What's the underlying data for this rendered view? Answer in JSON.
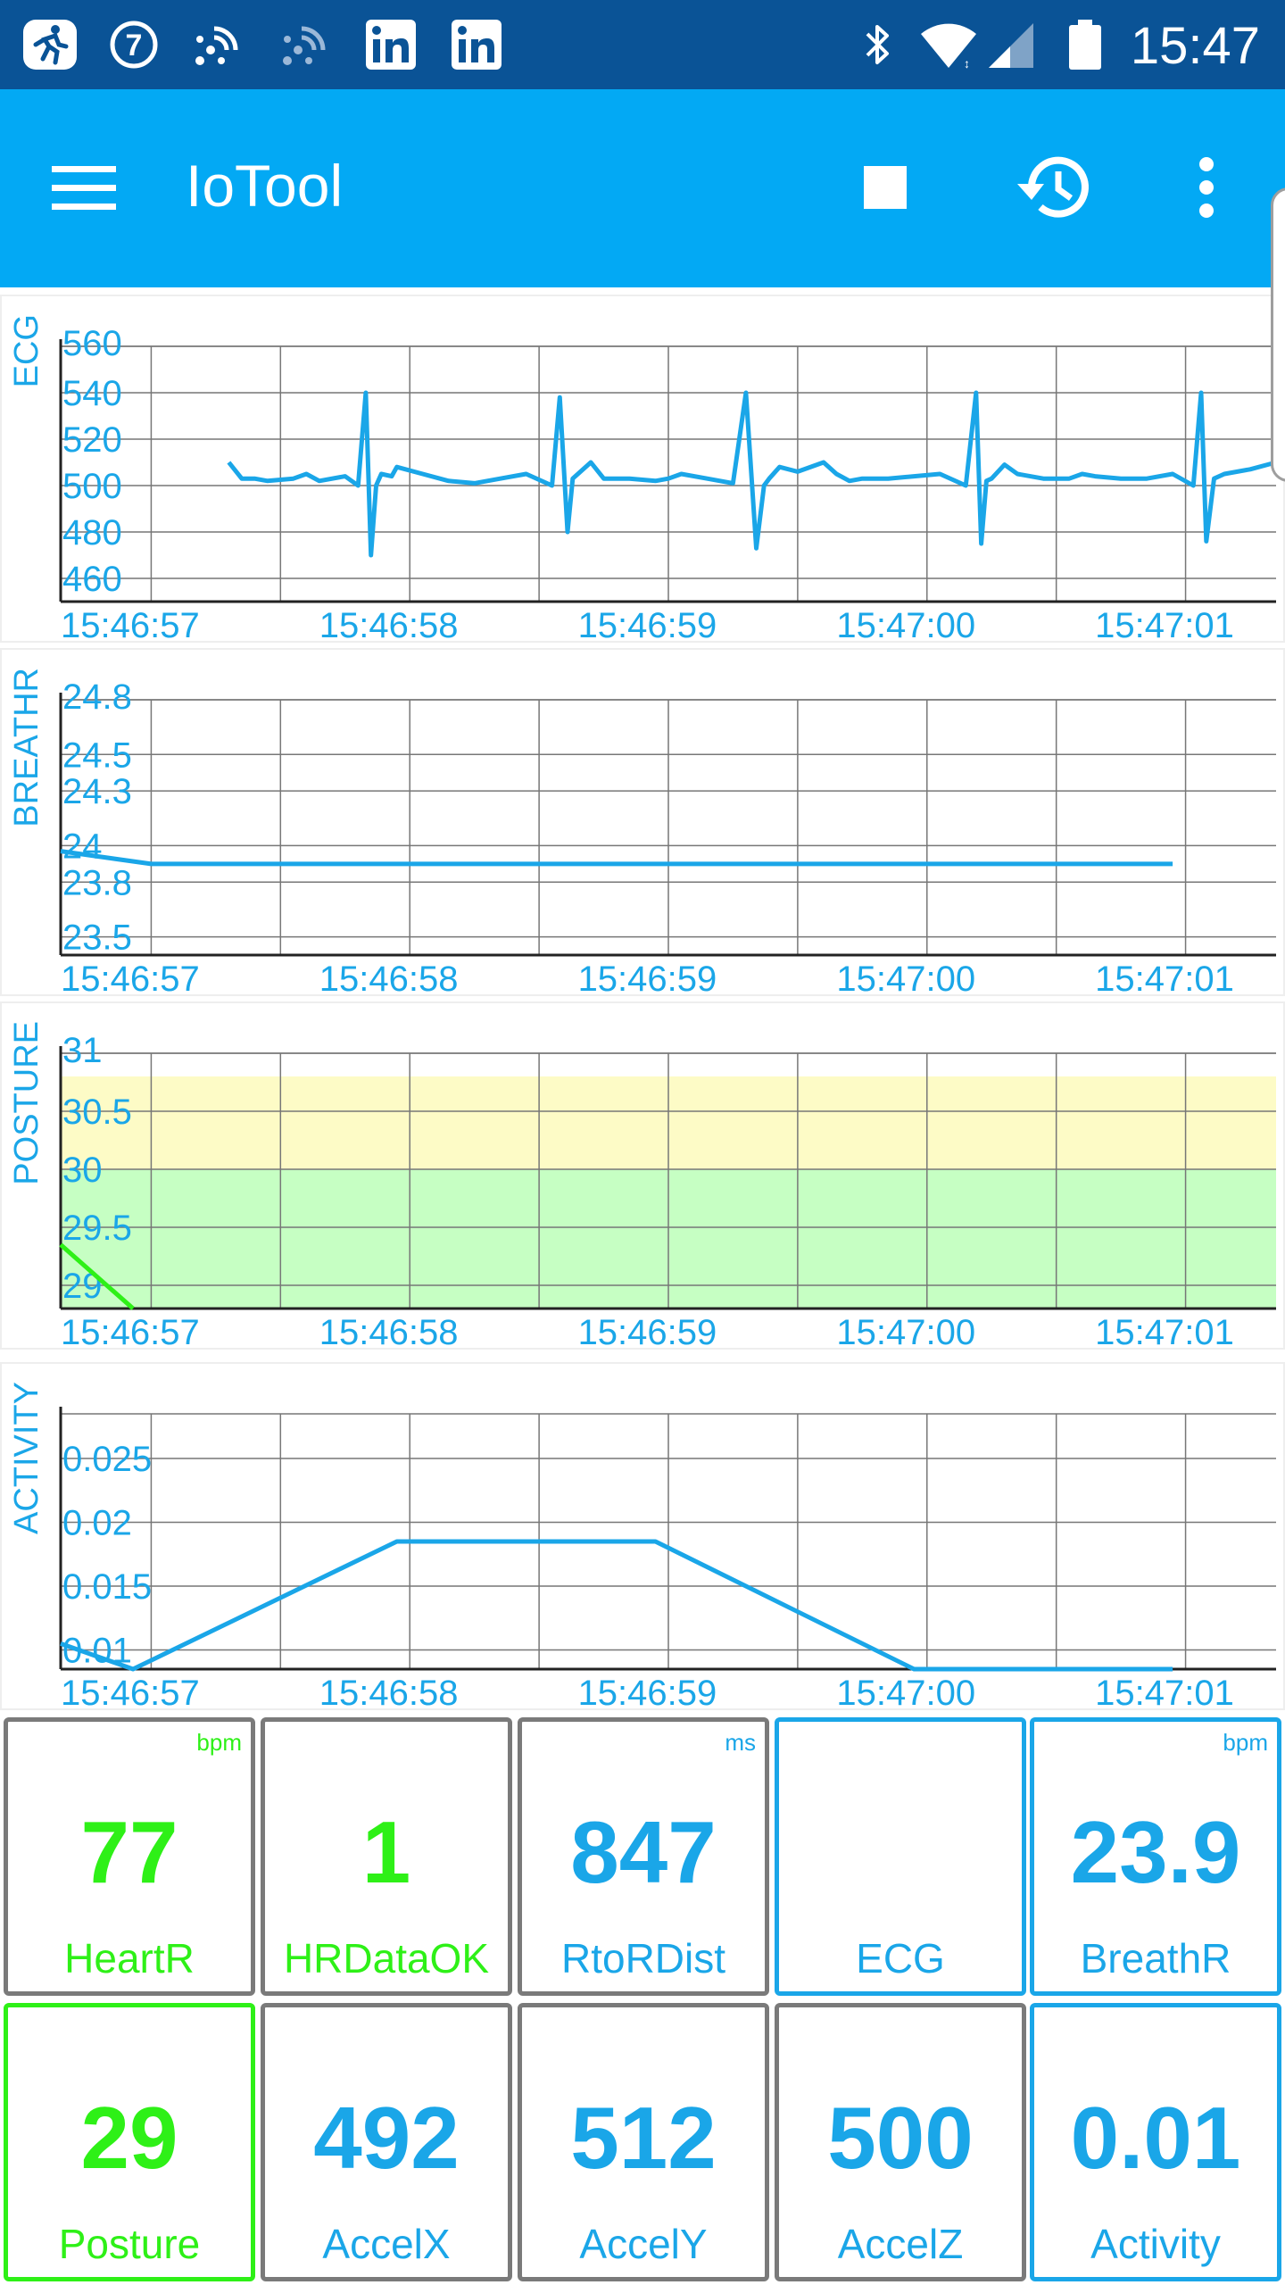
{
  "status_bar": {
    "time": "15:47",
    "notification_icons": [
      "running-app-icon",
      "seven-badge-icon",
      "satellite-icon",
      "satellite-faint-icon",
      "linkedin-icon",
      "linkedin-icon"
    ],
    "system_icons": [
      "bluetooth-icon",
      "wifi-icon",
      "signal-icon",
      "battery-icon"
    ]
  },
  "app_bar": {
    "title": "IoTool",
    "actions": [
      "menu-icon",
      "stop-icon",
      "history-icon",
      "more-vert-icon"
    ]
  },
  "colors": {
    "status_bar": "#0a5396",
    "app_bar": "#03a9f4",
    "accent_blue": "#1aa6e8",
    "accent_green": "#2ef017",
    "tile_border_gray": "#7a7a7a",
    "posture_yellow_band": "#fdfbc6",
    "posture_green_band": "#c6ffc3"
  },
  "chart_data": [
    {
      "id": "ecg",
      "type": "line",
      "ylabel": "ECG",
      "y_ticks": [
        "560",
        "540",
        "520",
        "500",
        "480",
        "460"
      ],
      "ylim": [
        450,
        560
      ],
      "x_ticks": [
        "15:46:57",
        "15:46:58",
        "15:46:59",
        "15:47:00",
        "15:47:01"
      ],
      "xlim": [
        0,
        4.7
      ],
      "grid": true,
      "series": [
        {
          "color": "#1aa6e8",
          "x": [
            0.65,
            0.7,
            0.75,
            0.8,
            0.9,
            0.95,
            1.0,
            1.1,
            1.15,
            1.18,
            1.2,
            1.22,
            1.24,
            1.28,
            1.3,
            1.4,
            1.5,
            1.6,
            1.7,
            1.8,
            1.9,
            1.93,
            1.96,
            1.98,
            2.0,
            2.05,
            2.1,
            2.2,
            2.3,
            2.35,
            2.4,
            2.5,
            2.6,
            2.65,
            2.69,
            2.72,
            2.74,
            2.78,
            2.85,
            2.95,
            3.0,
            3.05,
            3.1,
            3.2,
            3.3,
            3.4,
            3.5,
            3.54,
            3.56,
            3.58,
            3.6,
            3.65,
            3.7,
            3.8,
            3.9,
            3.95,
            4.0,
            4.1,
            4.2,
            4.3,
            4.38,
            4.41,
            4.43,
            4.46,
            4.5,
            4.6,
            4.7
          ],
          "y": [
            510,
            503,
            503,
            502,
            503,
            505,
            502,
            504,
            500,
            540,
            470,
            500,
            505,
            504,
            508,
            505,
            502,
            501,
            503,
            505,
            500,
            538,
            480,
            503,
            505,
            510,
            503,
            503,
            502,
            503,
            505,
            503,
            501,
            540,
            473,
            500,
            503,
            508,
            506,
            510,
            505,
            502,
            503,
            503,
            504,
            505,
            500,
            540,
            475,
            502,
            503,
            509,
            505,
            503,
            503,
            505,
            504,
            503,
            503,
            505,
            500,
            540,
            476,
            503,
            505,
            507,
            510
          ]
        }
      ]
    },
    {
      "id": "breathr",
      "type": "line",
      "ylabel": "BREATHR",
      "y_ticks": [
        "24.8",
        "24.5",
        "24.3",
        "24",
        "23.8",
        "23.5"
      ],
      "ylim": [
        23.4,
        24.8
      ],
      "x_ticks": [
        "15:46:57",
        "15:46:58",
        "15:46:59",
        "15:47:00",
        "15:47:01"
      ],
      "xlim": [
        0,
        4.7
      ],
      "grid": true,
      "series": [
        {
          "color": "#1aa6e8",
          "x": [
            0,
            0.35,
            4.3
          ],
          "y": [
            23.97,
            23.9,
            23.9
          ]
        }
      ]
    },
    {
      "id": "posture",
      "type": "line",
      "ylabel": "POSTURE",
      "y_ticks": [
        "31",
        "30.5",
        "30",
        "29.5",
        "29"
      ],
      "ylim": [
        28.8,
        31
      ],
      "x_ticks": [
        "15:46:57",
        "15:46:58",
        "15:46:59",
        "15:47:00",
        "15:47:01"
      ],
      "xlim": [
        0,
        4.7
      ],
      "grid": true,
      "bands": [
        {
          "from": 30,
          "to": 30.8,
          "color": "#fdfbc6"
        },
        {
          "from": 28.8,
          "to": 30,
          "color": "#c6ffc3"
        }
      ],
      "series": [
        {
          "color": "#2ef017",
          "x": [
            0,
            0.28
          ],
          "y": [
            29.35,
            28.8
          ]
        }
      ]
    },
    {
      "id": "activity",
      "type": "line",
      "ylabel": "ACTIVITY",
      "y_ticks": [
        "0.025",
        "0.02",
        "0.015",
        "0.01"
      ],
      "ylim": [
        0.0085,
        0.0285
      ],
      "x_ticks": [
        "15:46:57",
        "15:46:58",
        "15:46:59",
        "15:47:00",
        "15:47:01"
      ],
      "xlim": [
        0,
        4.7
      ],
      "grid": true,
      "series": [
        {
          "color": "#1aa6e8",
          "x": [
            0,
            0.28,
            1.3,
            2.3,
            3.3,
            4.3
          ],
          "y": [
            0.0105,
            0.0085,
            0.0185,
            0.0185,
            0.0085,
            0.0085
          ]
        }
      ]
    }
  ],
  "tiles": [
    {
      "value": "77",
      "label": "HeartR",
      "unit": "bpm",
      "text_color": "#2ef017",
      "border": "#7a7a7a"
    },
    {
      "value": "1",
      "label": "HRDataOK",
      "unit": "",
      "text_color": "#2ef017",
      "border": "#7a7a7a"
    },
    {
      "value": "847",
      "label": "RtoRDist",
      "unit": "ms",
      "text_color": "#1aa6e8",
      "border": "#7a7a7a"
    },
    {
      "value": "",
      "label": "ECG",
      "unit": "",
      "text_color": "#1aa6e8",
      "border": "#1aa6e8"
    },
    {
      "value": "23.9",
      "label": "BreathR",
      "unit": "bpm",
      "text_color": "#1aa6e8",
      "border": "#1aa6e8"
    },
    {
      "value": "29",
      "label": "Posture",
      "unit": "",
      "text_color": "#2ef017",
      "border": "#2ef017"
    },
    {
      "value": "492",
      "label": "AccelX",
      "unit": "",
      "text_color": "#1aa6e8",
      "border": "#7a7a7a"
    },
    {
      "value": "512",
      "label": "AccelY",
      "unit": "",
      "text_color": "#1aa6e8",
      "border": "#7a7a7a"
    },
    {
      "value": "500",
      "label": "AccelZ",
      "unit": "",
      "text_color": "#1aa6e8",
      "border": "#7a7a7a"
    },
    {
      "value": "0.01",
      "label": "Activity",
      "unit": "",
      "text_color": "#1aa6e8",
      "border": "#1aa6e8"
    }
  ]
}
